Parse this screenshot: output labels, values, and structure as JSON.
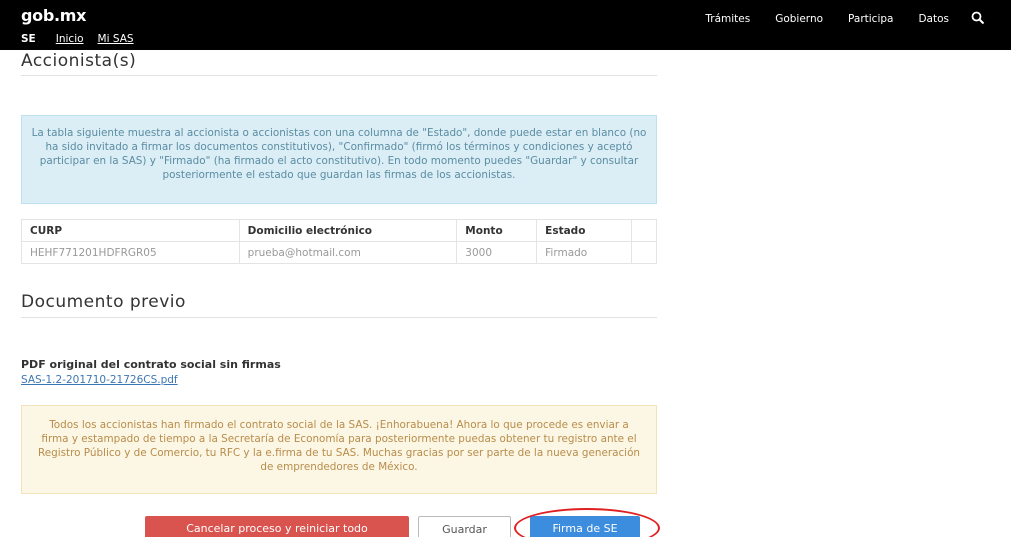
{
  "header": {
    "brand": "gob.mx",
    "nav": [
      "Trámites",
      "Gobierno",
      "Participa",
      "Datos"
    ],
    "subnav": {
      "section": "SE",
      "links": [
        "Inicio",
        "Mi SAS"
      ]
    }
  },
  "accionistas": {
    "title": "Accionista(s)",
    "info": "La tabla siguiente muestra al accionista o accionistas con una columna de \"Estado\", donde puede estar en blanco (no ha sido invitado a firmar los documentos constitutivos), \"Confirmado\" (firmó los términos y condiciones y aceptó participar en la SAS) y \"Firmado\" (ha firmado el acto constitutivo). En todo momento puedes \"Guardar\" y consultar posteriormente el estado que guardan las firmas de los accionistas.",
    "table": {
      "headers": [
        "CURP",
        "Domicilio electrónico",
        "Monto",
        "Estado"
      ],
      "rows": [
        [
          "HEHF771201HDFRGR05",
          "prueba@hotmail.com",
          "3000",
          "Firmado"
        ]
      ]
    }
  },
  "documento": {
    "title": "Documento previo",
    "pdf_label": "PDF original del contrato social sin firmas",
    "pdf_link": "SAS-1.2-201710-21726CS.pdf",
    "notice": "Todos los accionistas han firmado el contrato social de la SAS. ¡Enhorabuena! Ahora lo que procede es enviar a firma y estampado de tiempo a la Secretaría de Economía para posteriormente puedas obtener tu registro ante el Registro Público y de Comercio, tu RFC y la e.firma de tu SAS. Muchas gracias por ser parte de la nueva generación de emprendedores de México."
  },
  "actions": {
    "cancel": "Cancelar proceso y reiniciar todo",
    "save": "Guardar",
    "sign": "Firma de SE"
  },
  "colors": {
    "header": "#000000",
    "danger": "#d9534f",
    "primary": "#3c8dde",
    "highlight": "#e02020"
  }
}
